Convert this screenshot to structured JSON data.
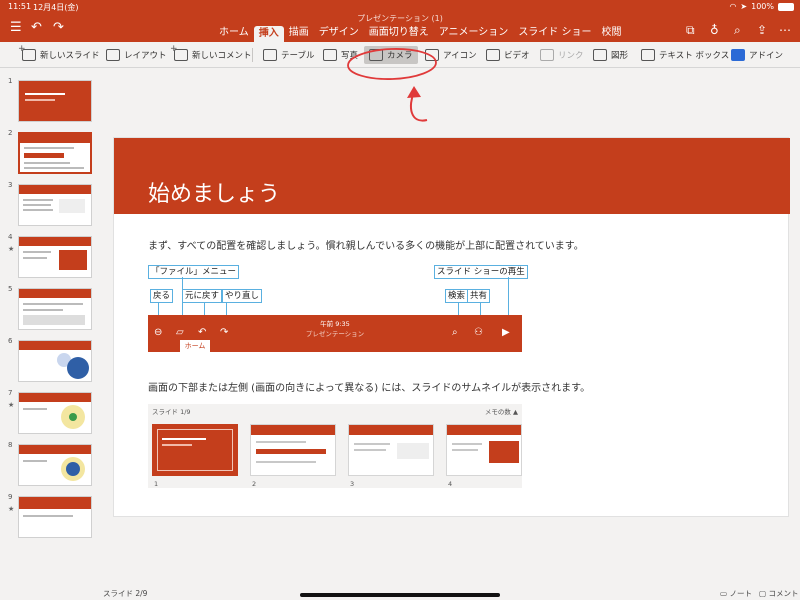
{
  "status": {
    "time": "11:51",
    "date": "12月4日(金)",
    "battery": "100%"
  },
  "document": {
    "title": "プレゼンテーション (1)"
  },
  "tabs": [
    "ホーム",
    "挿入",
    "描画",
    "デザイン",
    "画面切り替え",
    "アニメーション",
    "スライド ショー",
    "校閲"
  ],
  "active_tab": "挿入",
  "ribbon": {
    "new_slide": "新しいスライド",
    "layout": "レイアウト",
    "new_comment": "新しいコメント",
    "table": "テーブル",
    "photo": "写真",
    "camera": "カメラ",
    "icons": "アイコン",
    "video": "ビデオ",
    "link": "リンク",
    "shapes": "図形",
    "textbox": "テキスト ボックス",
    "addins": "アドイン"
  },
  "thumbnails": [
    {
      "num": "1",
      "star": ""
    },
    {
      "num": "2",
      "star": ""
    },
    {
      "num": "3",
      "star": ""
    },
    {
      "num": "4",
      "star": "★"
    },
    {
      "num": "5",
      "star": ""
    },
    {
      "num": "6",
      "star": ""
    },
    {
      "num": "7",
      "star": "★"
    },
    {
      "num": "8",
      "star": ""
    },
    {
      "num": "9",
      "star": "★"
    }
  ],
  "slide": {
    "title": "始めましょう",
    "intro": "まず、すべての配置を確認しましょう。慣れ親しんでいる多くの機能が上部に配置されています。",
    "callouts": {
      "file_menu": "「ファイル」メニュー",
      "back": "戻る",
      "undo": "元に戻す",
      "redo": "やり直し",
      "slideshow": "スライド ショーの再生",
      "search": "検索",
      "share": "共有"
    },
    "mock_bar": {
      "time": "午前 9:35",
      "subtitle": "プレゼンテーション",
      "tab": "ホーム"
    },
    "desc": "画面の下部または左側 (画面の向きによって異なる) には、スライドのサムネイルが表示されます。",
    "mock_pane": {
      "label": "スライド 1/9",
      "notes": "メモの数 ▲",
      "nums": [
        "1",
        "2",
        "3",
        "4"
      ]
    }
  },
  "bottom": {
    "counter": "スライド 2/9",
    "notes": "ノート",
    "comments": "コメント"
  },
  "colors": {
    "accent": "#c43e1c",
    "annotation": "#e03a3a",
    "callout_line": "#5ab0e0"
  }
}
